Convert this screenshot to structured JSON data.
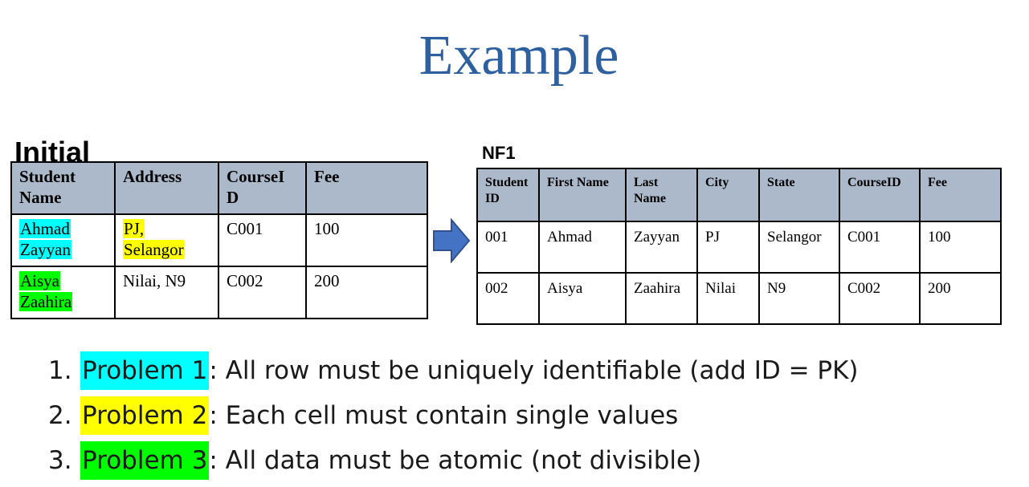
{
  "title": "Example",
  "colors": {
    "title": "#2e5f9e",
    "header_bg": "#acb9ca",
    "highlight_cyan": "#00ffff",
    "highlight_yellow": "#ffff00",
    "highlight_green": "#00ff00",
    "arrow": "#4472c4"
  },
  "initial": {
    "label": "Initial",
    "headers": [
      "Student Name",
      "Address",
      "CourseI D",
      "Fee"
    ],
    "rows": [
      {
        "name_line1": "Ahmad",
        "name_line2": "Zayyan",
        "address_line1": "PJ,",
        "address_line2": "Selangor",
        "course": "C001",
        "fee": "100"
      },
      {
        "name_line1": "Aisya",
        "name_line2": "Zaahira",
        "address": "Nilai, N9",
        "course": "C002",
        "fee": "200"
      }
    ]
  },
  "arrow_icon": "right-arrow-icon",
  "nf1": {
    "label": "NF1",
    "headers": [
      "Student ID",
      "First Name",
      "Last Name",
      "City",
      "State",
      "CourseID",
      "Fee"
    ],
    "rows": [
      [
        "001",
        "Ahmad",
        "Zayyan",
        "PJ",
        "Selangor",
        "C001",
        "100"
      ],
      [
        "002",
        "Aisya",
        "Zaahira",
        "Nilai",
        "N9",
        "C002",
        "200"
      ]
    ]
  },
  "problems": [
    {
      "num": "1.",
      "tag": "Problem 1",
      "text": ": All row must be uniquely identifiable (add ID = PK)"
    },
    {
      "num": "2.",
      "tag": "Problem 2",
      "text": ": Each cell must contain single values"
    },
    {
      "num": "3.",
      "tag": "Problem 3",
      "text": ": All data must be atomic (not divisible)"
    }
  ]
}
